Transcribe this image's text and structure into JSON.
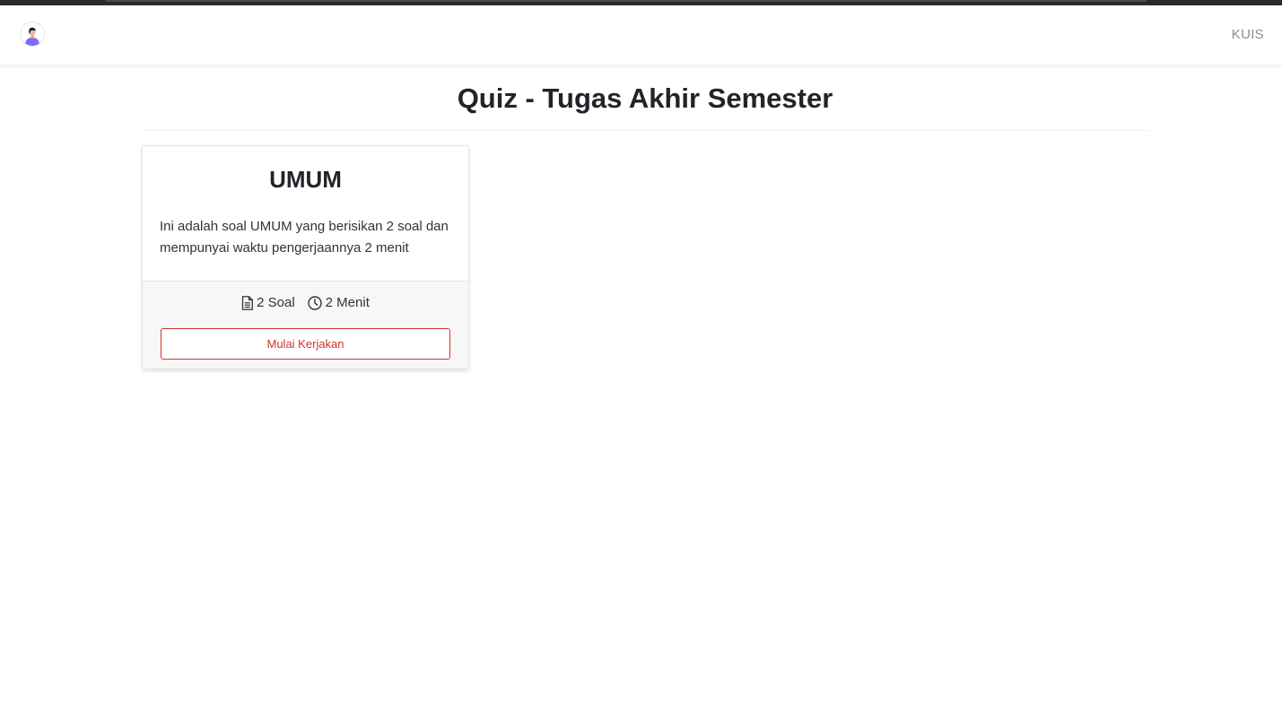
{
  "navbar": {
    "avatar_icon": "user-avatar-icon",
    "menu_link": "KUIS"
  },
  "page": {
    "title": "Quiz - Tugas Akhir Semester"
  },
  "quiz_cards": [
    {
      "title": "UMUM",
      "description": "Ini adalah soal UMUM yang berisikan 2 soal dan mempunyai waktu pengerjaannya 2 menit",
      "question_count_label": "2 Soal",
      "question_icon": "document-icon",
      "duration_label": "2 Menit",
      "duration_icon": "clock-icon",
      "start_button_label": "Mulai Kerjakan"
    }
  ],
  "colors": {
    "accent": "#d0342c",
    "text": "#212529",
    "muted_link": "#8c8c8c",
    "footer_bg": "#f7f7f8"
  }
}
